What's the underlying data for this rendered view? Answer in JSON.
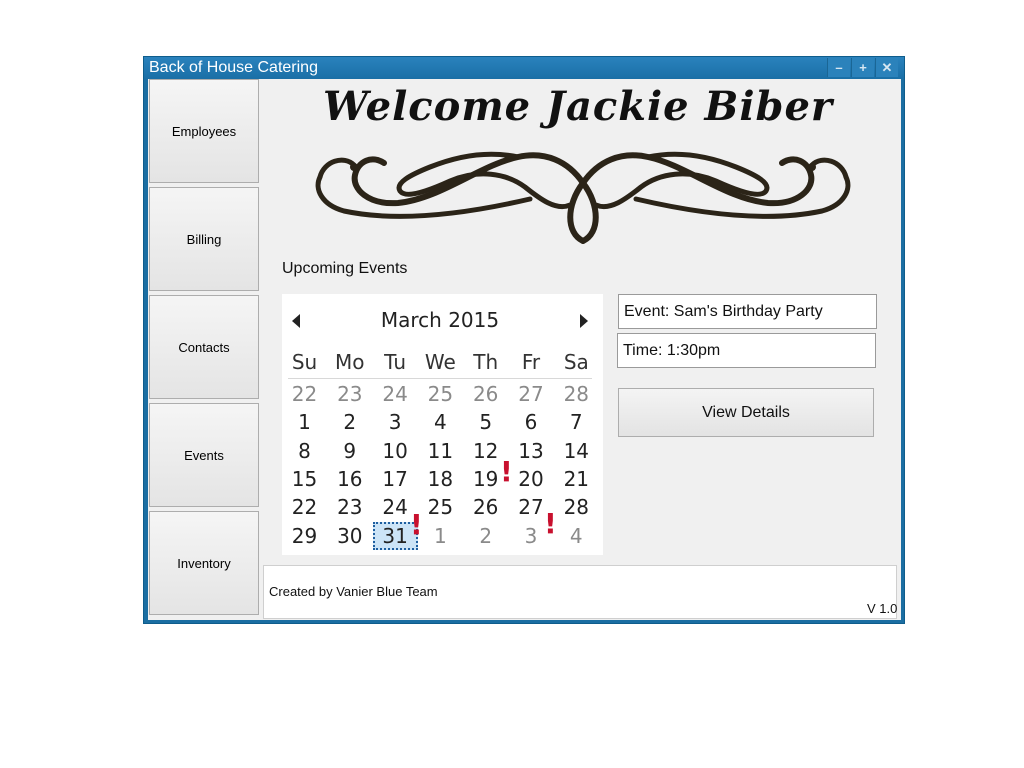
{
  "window": {
    "title": "Back of House Catering",
    "minimize_glyph": "–",
    "maximize_glyph": "+",
    "close_glyph": "✕"
  },
  "sidebar": {
    "items": [
      {
        "label": "Employees"
      },
      {
        "label": "Billing"
      },
      {
        "label": "Contacts"
      },
      {
        "label": "Events"
      },
      {
        "label": "Inventory"
      }
    ]
  },
  "header": {
    "welcome": "Welcome Jackie Biber"
  },
  "events": {
    "section_label": "Upcoming Events",
    "event_text": "Event: Sam's Birthday Party",
    "time_text": "Time: 1:30pm",
    "view_details_label": "View Details"
  },
  "calendar": {
    "month_label": "March 2015",
    "weekdays": [
      "Su",
      "Mo",
      "Tu",
      "We",
      "Th",
      "Fr",
      "Sa"
    ],
    "weeks": [
      [
        "22",
        "23",
        "24",
        "25",
        "26",
        "27",
        "28"
      ],
      [
        "1",
        "2",
        "3",
        "4",
        "5",
        "6",
        "7"
      ],
      [
        "8",
        "9",
        "10",
        "11",
        "12",
        "13",
        "14"
      ],
      [
        "15",
        "16",
        "17",
        "18",
        "19",
        "20",
        "21"
      ],
      [
        "22",
        "23",
        "24",
        "25",
        "26",
        "27",
        "28"
      ],
      [
        "29",
        "30",
        "31",
        "1",
        "2",
        "3",
        "4"
      ]
    ],
    "selected_day": "31",
    "event_marker_glyph": "!",
    "marker_color": "#c8102e"
  },
  "footer": {
    "credits": "Created by Vanier Blue Team",
    "version": "V 1.0"
  }
}
